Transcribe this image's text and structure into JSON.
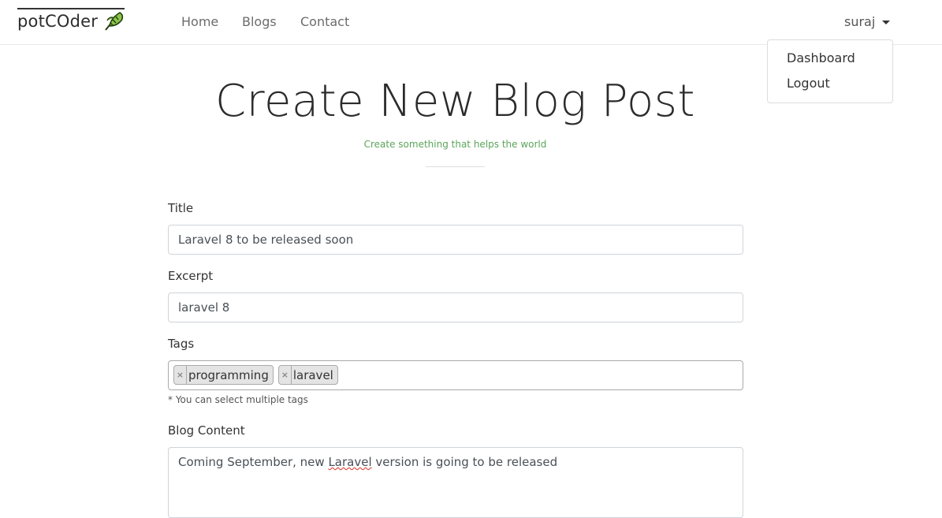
{
  "brand": {
    "name": "potCOder",
    "icon": "leaf-icon"
  },
  "nav": [
    {
      "label": "Home"
    },
    {
      "label": "Blogs"
    },
    {
      "label": "Contact"
    }
  ],
  "user": {
    "name": "suraj",
    "menu": [
      {
        "label": "Dashboard"
      },
      {
        "label": "Logout"
      }
    ]
  },
  "hero": {
    "title": "Create New Blog Post",
    "subtitle": "Create something that helps the world"
  },
  "form": {
    "title_label": "Title",
    "title_value": "Laravel 8 to be released soon",
    "excerpt_label": "Excerpt",
    "excerpt_value": "laravel 8",
    "tags_label": "Tags",
    "tags": [
      "programming",
      "laravel"
    ],
    "tags_remove_symbol": "×",
    "tags_help": "* You can select multiple tags",
    "content_label": "Blog Content",
    "content_before": "Coming September, new ",
    "content_misspelled": "Laravel",
    "content_after": " version is going to be released"
  },
  "colors": {
    "accent_green": "#5aa55a",
    "leaf_green": "#8bc34a"
  }
}
